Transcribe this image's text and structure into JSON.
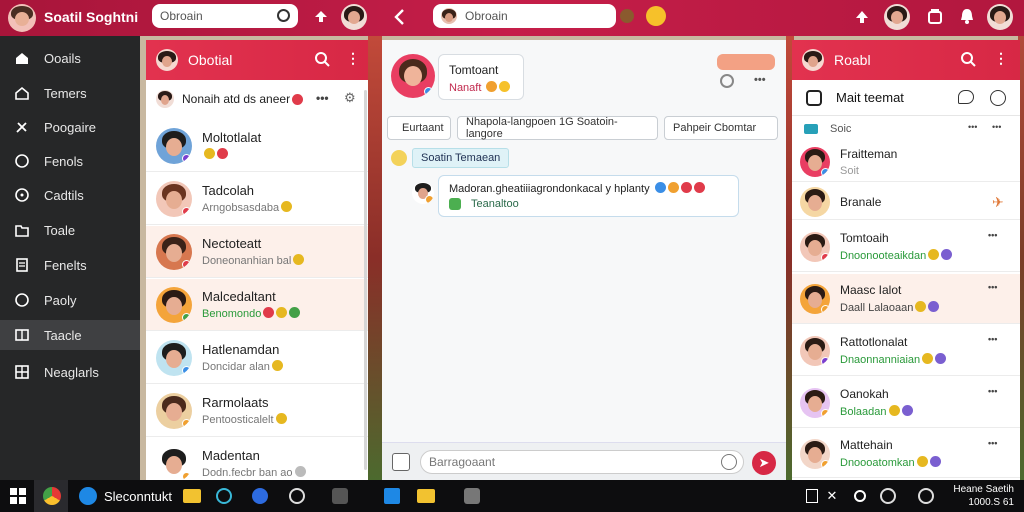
{
  "topbar": {
    "app_title": "Soatil Soghtni",
    "search_left_placeholder": "Obroain",
    "search_mid_value": "Obroain"
  },
  "leftnav": {
    "items": [
      {
        "label": "Ooails",
        "icon": "home-icon"
      },
      {
        "label": "Temers",
        "icon": "house-icon"
      },
      {
        "label": "Poogaire",
        "icon": "tools-icon"
      },
      {
        "label": "Fenols",
        "icon": "circle-icon"
      },
      {
        "label": "Cadtils",
        "icon": "compass-icon"
      },
      {
        "label": "Toale",
        "icon": "folder-icon"
      },
      {
        "label": "Fenelts",
        "icon": "document-icon"
      },
      {
        "label": "Paoly",
        "icon": "chat-icon"
      },
      {
        "label": "Taacle",
        "icon": "book-icon"
      },
      {
        "label": "Neaglarls",
        "icon": "grid-icon"
      }
    ],
    "active_index": 8
  },
  "chatlist": {
    "title": "Obotial",
    "filter_text": "Nonaih atd ds aneer",
    "rows": [
      {
        "name": "Moltotlalat",
        "sub": ""
      },
      {
        "name": "Tadcolah",
        "sub": "Arngobsasdaba"
      },
      {
        "name": "Nectoteatt",
        "sub": "Doneonanhian bal"
      },
      {
        "name": "Malcedaltant",
        "sub": "Benomondo"
      },
      {
        "name": "Hatlenamdan",
        "sub": "Doncidar alan"
      },
      {
        "name": "Rarmolaats",
        "sub": "Pentoosticalelt"
      },
      {
        "name": "Madentan",
        "sub": "Dodn.fecbr ban ao"
      }
    ]
  },
  "conversation": {
    "contact_title": "Tomtoant",
    "contact_sub": "Nanaft",
    "chips": [
      "Eurtaant",
      "Nhapola-langpoen 1G Soatoin-langore",
      "Pahpeir Cbomtar"
    ],
    "label_chip": "Soatin Temaean",
    "message_line1": "Madoran.gheatiiiagrondonkacal y hplanty",
    "message_line2": "Teanaltoo",
    "compose_placeholder": "Barragoaant"
  },
  "rightpanel": {
    "title": "Roabl",
    "subheader": "Mait teemat",
    "section_label": "Soic",
    "rows": [
      {
        "name": "Fraitteman",
        "sub": "Soit"
      },
      {
        "name": "Branale",
        "sub": ""
      },
      {
        "name": "Tomtoaih",
        "sub": "Dnoonooteaikdan"
      },
      {
        "name": "Maasc Ialot",
        "sub": "Daall  Lalaoaan"
      },
      {
        "name": "Rattotlonalat",
        "sub": "Dnaonnanniaian"
      },
      {
        "name": "Oanokah",
        "sub": "Bolaadan"
      },
      {
        "name": "Mattehain",
        "sub": "Dnoooatomkan"
      }
    ]
  },
  "taskbar": {
    "app_label": "Sleconntukt",
    "clock_line1": "Heane Saetih",
    "clock_line2": "1000.S 61"
  },
  "colors": {
    "brand_red": "#d72845",
    "nav_bg": "#262728",
    "accent_green": "#2a9a3a"
  }
}
